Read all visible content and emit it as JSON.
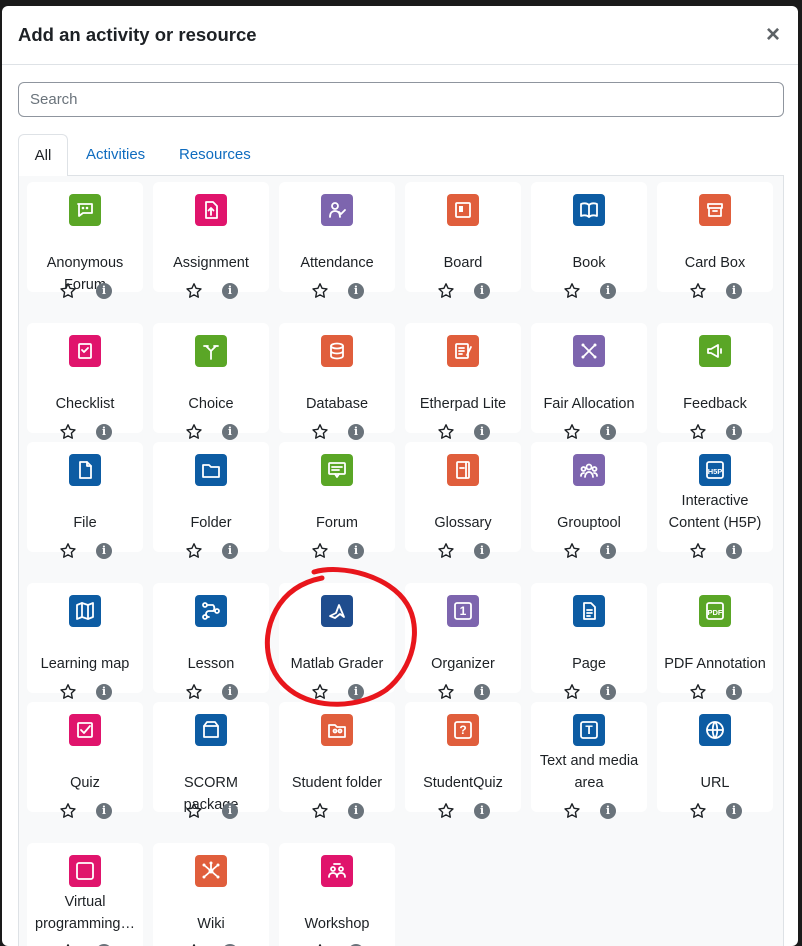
{
  "dialog": {
    "title": "Add an activity or resource",
    "close_glyph": "×",
    "search_placeholder": "Search"
  },
  "tabs": [
    {
      "label": "All",
      "active": true
    },
    {
      "label": "Activities",
      "active": false
    },
    {
      "label": "Resources",
      "active": false
    }
  ],
  "colors": {
    "green": "#5aa626",
    "pink": "#e0146c",
    "purple": "#7d65ae",
    "orange": "#e05e3c",
    "blue": "#0d5ca3",
    "dark_blue": "#1f4d8e",
    "link": "#0f6cbf",
    "annotation_red": "#e8161c"
  },
  "items": [
    {
      "name": "Anonymous Forum",
      "icon": "anonymous-forum-icon",
      "color": "#5aa626"
    },
    {
      "name": "Assignment",
      "icon": "assignment-icon",
      "color": "#e0146c"
    },
    {
      "name": "Attendance",
      "icon": "attendance-icon",
      "color": "#7d65ae"
    },
    {
      "name": "Board",
      "icon": "board-icon",
      "color": "#e05e3c"
    },
    {
      "name": "Book",
      "icon": "book-icon",
      "color": "#0d5ca3"
    },
    {
      "name": "Card Box",
      "icon": "card-box-icon",
      "color": "#e05e3c"
    },
    {
      "name": "Checklist",
      "icon": "checklist-icon",
      "color": "#e0146c"
    },
    {
      "name": "Choice",
      "icon": "choice-icon",
      "color": "#5aa626"
    },
    {
      "name": "Database",
      "icon": "database-icon",
      "color": "#e05e3c"
    },
    {
      "name": "Etherpad Lite",
      "icon": "etherpad-icon",
      "color": "#e05e3c"
    },
    {
      "name": "Fair Allocation",
      "icon": "fair-allocation-icon",
      "color": "#7d65ae"
    },
    {
      "name": "Feedback",
      "icon": "feedback-icon",
      "color": "#5aa626"
    },
    {
      "name": "File",
      "icon": "file-icon",
      "color": "#0d5ca3"
    },
    {
      "name": "Folder",
      "icon": "folder-icon",
      "color": "#0d5ca3"
    },
    {
      "name": "Forum",
      "icon": "forum-icon",
      "color": "#5aa626"
    },
    {
      "name": "Glossary",
      "icon": "glossary-icon",
      "color": "#e05e3c"
    },
    {
      "name": "Grouptool",
      "icon": "grouptool-icon",
      "color": "#7d65ae"
    },
    {
      "name": "Interactive Content (H5P)",
      "icon": "h5p-icon",
      "color": "#0d5ca3",
      "glyph": "H5P"
    },
    {
      "name": "Learning map",
      "icon": "learning-map-icon",
      "color": "#0d5ca3"
    },
    {
      "name": "Lesson",
      "icon": "lesson-icon",
      "color": "#0d5ca3"
    },
    {
      "name": "Matlab Grader",
      "icon": "matlab-icon",
      "color": "#1f4d8e"
    },
    {
      "name": "Organizer",
      "icon": "organizer-icon",
      "color": "#7d65ae",
      "glyph": "1"
    },
    {
      "name": "Page",
      "icon": "page-icon",
      "color": "#0d5ca3"
    },
    {
      "name": "PDF Annotation",
      "icon": "pdf-annotation-icon",
      "color": "#5aa626",
      "glyph": "PDF"
    },
    {
      "name": "Quiz",
      "icon": "quiz-icon",
      "color": "#e0146c"
    },
    {
      "name": "SCORM package",
      "icon": "scorm-icon",
      "color": "#0d5ca3"
    },
    {
      "name": "Student folder",
      "icon": "student-folder-icon",
      "color": "#e05e3c"
    },
    {
      "name": "StudentQuiz",
      "icon": "studentquiz-icon",
      "color": "#e05e3c",
      "glyph": "?"
    },
    {
      "name": "Text and media area",
      "icon": "text-media-icon",
      "color": "#0d5ca3",
      "glyph": "T"
    },
    {
      "name": "URL",
      "icon": "url-icon",
      "color": "#0d5ca3"
    },
    {
      "name": "Virtual programming…",
      "icon": "vpl-icon",
      "color": "#e0146c",
      "glyph": "</>"
    },
    {
      "name": "Wiki",
      "icon": "wiki-icon",
      "color": "#e05e3c"
    },
    {
      "name": "Workshop",
      "icon": "workshop-icon",
      "color": "#e0146c"
    }
  ],
  "info_glyph": "i"
}
